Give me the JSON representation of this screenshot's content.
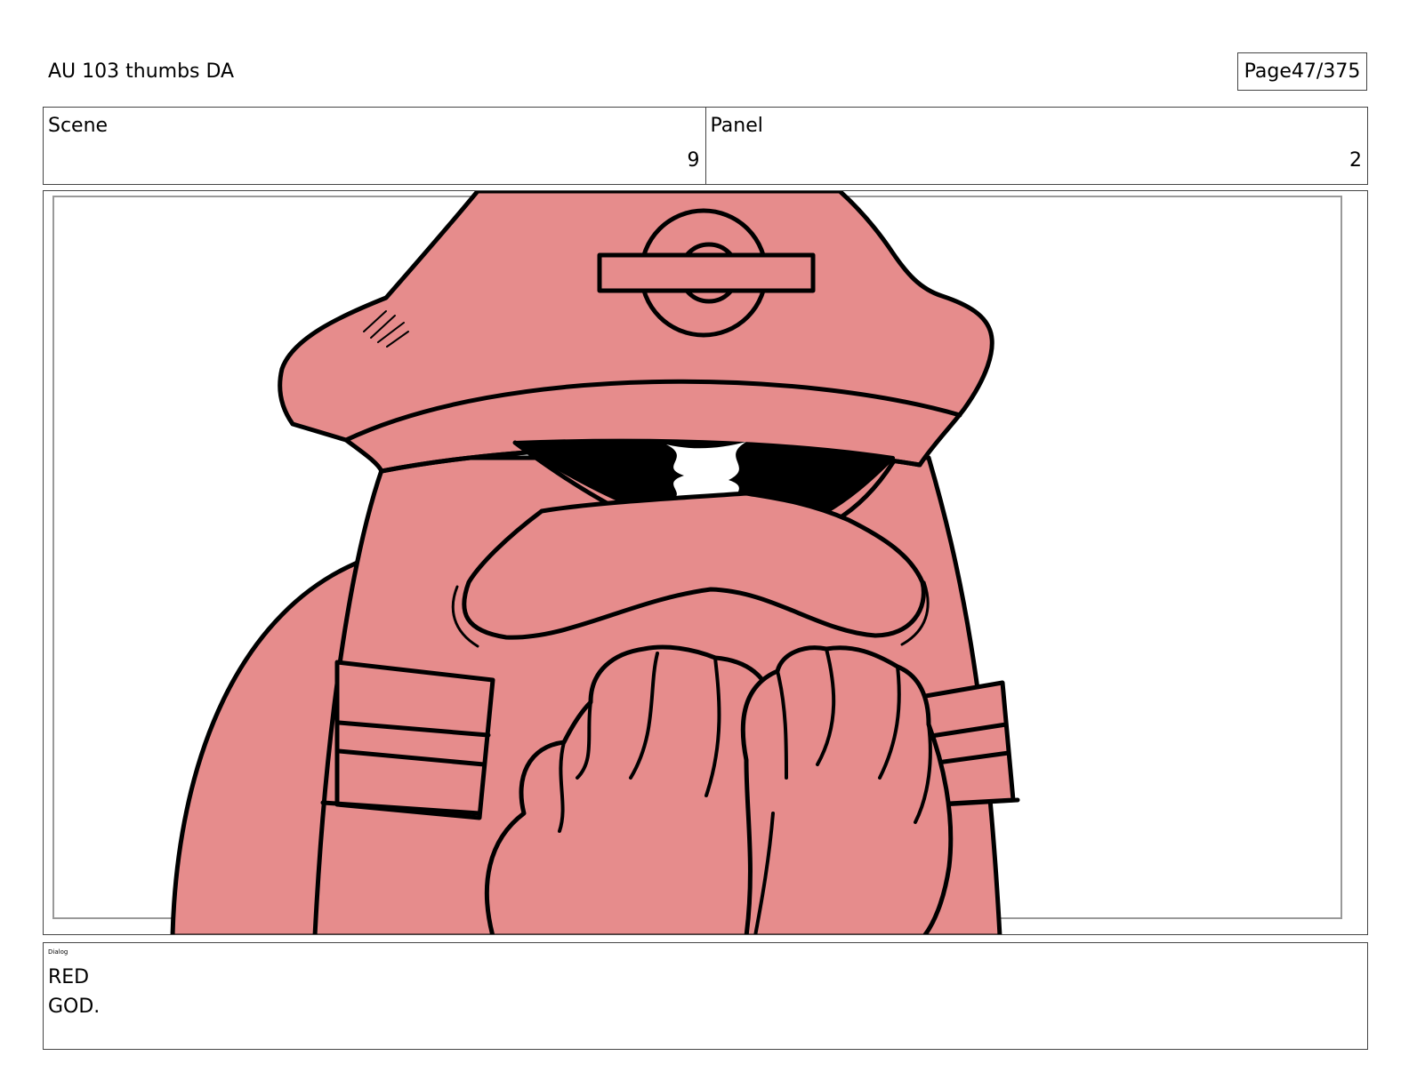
{
  "header": {
    "title": "AU 103 thumbs DA",
    "page_label": "Page",
    "page_number": "47/375"
  },
  "info": {
    "scene_label": "Scene",
    "scene_value": "9",
    "panel_label": "Panel",
    "panel_value": "2"
  },
  "frame": {
    "image": "cartoon-character-red-hat-hands-clasped",
    "fill_color": "#e68c8c",
    "line_color": "#000000"
  },
  "dialog": {
    "label": "Dialog",
    "lines": [
      "RED",
      "GOD."
    ]
  }
}
